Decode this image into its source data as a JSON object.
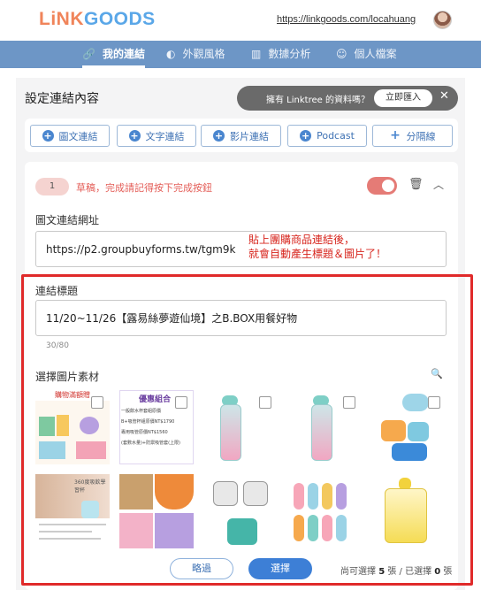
{
  "brand": {
    "logo_part1": "LiNK",
    "logo_part2": "GOODS",
    "site_url": "https://linkgoods.com/locahuang"
  },
  "nav": {
    "items": [
      {
        "label": "我的連結",
        "icon": "link-icon",
        "glyph": "🔗",
        "active": true
      },
      {
        "label": "外觀風格",
        "icon": "palette-icon",
        "glyph": "◐",
        "active": false
      },
      {
        "label": "數據分析",
        "icon": "bar-chart-icon",
        "glyph": "▥",
        "active": false
      },
      {
        "label": "個人檔案",
        "icon": "user-icon",
        "glyph": "☺",
        "active": false
      }
    ]
  },
  "main": {
    "section_title": "設定連結內容",
    "import_banner": {
      "text": "擁有 Linktree 的資料嗎？",
      "button": "立即匯入",
      "close": "✕"
    },
    "add_buttons": [
      {
        "label": "圖文連結"
      },
      {
        "label": "文字連結"
      },
      {
        "label": "影片連結"
      },
      {
        "label": "Podcast"
      },
      {
        "label": "分隔線"
      }
    ],
    "draft": {
      "number": "1",
      "message": "草稿，完成請記得按下完成按鈕",
      "enabled": true
    },
    "url_field": {
      "label": "圖文連結網址",
      "value": "https://p2.groupbuyforms.tw/tgm9k"
    },
    "annotation": {
      "line1": "貼上團購商品連結後，",
      "line2": "就會自動產生標題＆圖片了！"
    },
    "title_field": {
      "label": "連結標題",
      "value": "11/20~11/26【露易絲夢遊仙境】之B.BOX用餐好物",
      "counter": "30/80"
    },
    "image_picker": {
      "label": "選擇圖片素材",
      "thumb1_lines": [
        "購物滿額贈"
      ],
      "thumb2_lines": [
        "優惠組合",
        "一般飲水杯套組原價",
        "B+吸管杯組原價NT$1790",
        "專用吸管原價NT$1560",
        "(套數水量)+防禦吸管套(上限)"
      ],
      "thumb6_text": "360度吸飲學習杯"
    },
    "actions": {
      "skip": "略過",
      "select": "選擇"
    },
    "selection_info": {
      "prefix": "尚可選擇",
      "remaining": "5",
      "mid": "張 / 已選擇",
      "selected": "0",
      "suffix": "張"
    }
  }
}
